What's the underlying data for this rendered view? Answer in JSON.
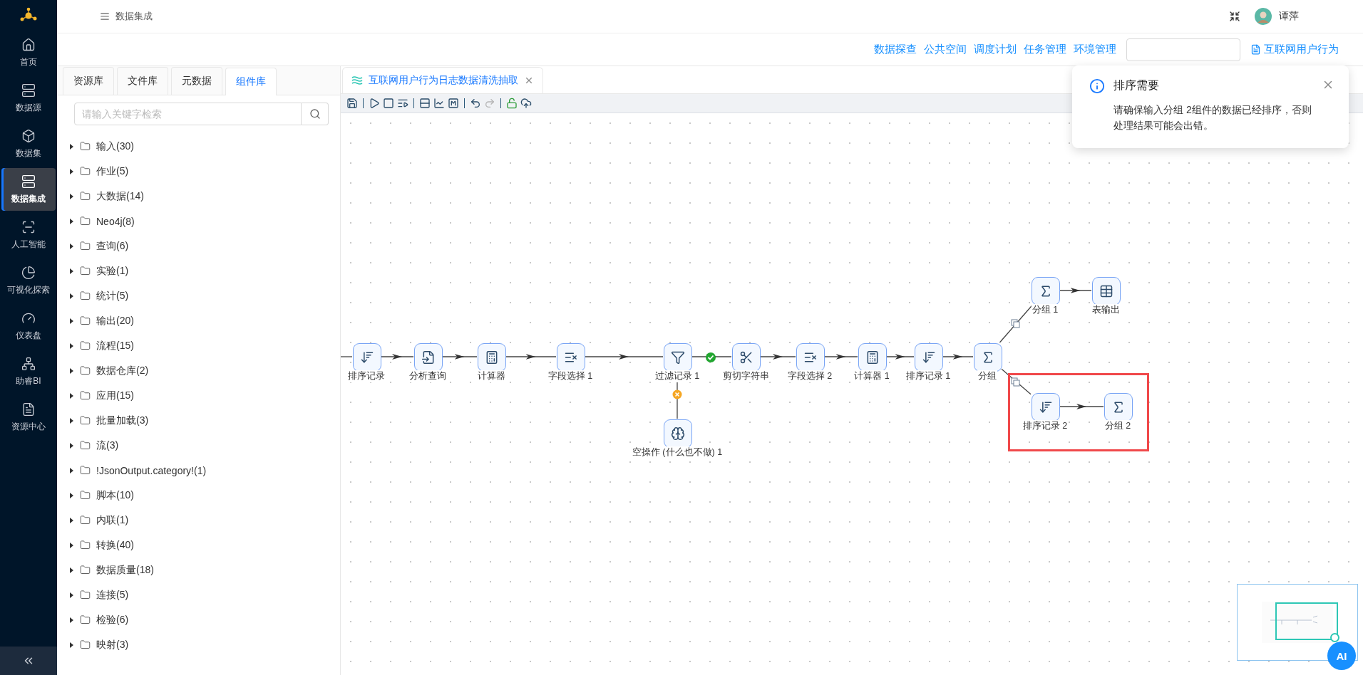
{
  "sidebar": {
    "items": [
      {
        "kind": "home",
        "label": "首页",
        "selected": false
      },
      {
        "kind": "datasource",
        "label": "数据源",
        "selected": false
      },
      {
        "kind": "dataset",
        "label": "数据集",
        "selected": false
      },
      {
        "kind": "integration",
        "label": "数据集成",
        "selected": true
      },
      {
        "kind": "ai",
        "label": "人工智能",
        "selected": false
      },
      {
        "kind": "chart",
        "label": "可视化探索",
        "selected": false
      },
      {
        "kind": "dashboard",
        "label": "仪表盘",
        "selected": false
      },
      {
        "kind": "bi",
        "label": "助睿BI",
        "selected": false
      },
      {
        "kind": "resource",
        "label": "资源中心",
        "selected": false
      }
    ]
  },
  "header": {
    "breadcrumb": "数据集成",
    "user": "谭萍"
  },
  "top_links": [
    "数据探查",
    "公共空间",
    "调度计划",
    "任务管理",
    "环境管理"
  ],
  "doc_link": "互联网用户行为",
  "left_panel": {
    "tabs": [
      {
        "label": "资源库",
        "selected": false
      },
      {
        "label": "文件库",
        "selected": false
      },
      {
        "label": "元数据",
        "selected": false
      },
      {
        "label": "组件库",
        "selected": true
      }
    ],
    "search": {
      "placeholder": "请输入关键字检索"
    },
    "tree": [
      {
        "label": "输入(30)",
        "expanded": false
      },
      {
        "label": "作业(5)",
        "expanded": false
      },
      {
        "label": "大数据(14)",
        "expanded": false
      },
      {
        "label": "Neo4j(8)",
        "expanded": false
      },
      {
        "label": "查询(6)",
        "expanded": false
      },
      {
        "label": "实验(1)",
        "expanded": false
      },
      {
        "label": "统计(5)",
        "expanded": false
      },
      {
        "label": "输出(20)",
        "expanded": false
      },
      {
        "label": "流程(15)",
        "expanded": false
      },
      {
        "label": "数据仓库(2)",
        "expanded": false
      },
      {
        "label": "应用(15)",
        "expanded": false
      },
      {
        "label": "批量加载(3)",
        "expanded": false
      },
      {
        "label": "流(3)",
        "expanded": false
      },
      {
        "label": "!JsonOutput.category!(1)",
        "expanded": false
      },
      {
        "label": "脚本(10)",
        "expanded": false
      },
      {
        "label": "内联(1)",
        "expanded": false
      },
      {
        "label": "转换(40)",
        "expanded": false
      },
      {
        "label": "数据质量(18)",
        "expanded": false
      },
      {
        "label": "连接(5)",
        "expanded": false
      },
      {
        "label": "检验(6)",
        "expanded": false
      },
      {
        "label": "映射(3)",
        "expanded": false
      }
    ]
  },
  "editor": {
    "tab": {
      "title": "互联网用户行为日志数据清洗抽取",
      "selected": true
    },
    "toolbar": [
      {
        "kind": "save",
        "disabled": false
      },
      {
        "kind": "run",
        "disabled": false
      },
      {
        "kind": "stop",
        "disabled": false
      },
      {
        "kind": "debug",
        "disabled": false
      },
      {
        "kind": "layout",
        "disabled": false
      },
      {
        "kind": "axes",
        "disabled": false
      },
      {
        "kind": "mbox",
        "disabled": false
      },
      {
        "kind": "undo",
        "disabled": false
      },
      {
        "kind": "redo",
        "disabled": true
      },
      {
        "kind": "unlock",
        "disabled": false
      },
      {
        "kind": "upload",
        "disabled": false
      }
    ],
    "nodes": [
      {
        "kind": "sort",
        "label": "排序记录"
      },
      {
        "kind": "analytic",
        "label": "分析查询"
      },
      {
        "kind": "calculator",
        "label": "计算器"
      },
      {
        "kind": "fields",
        "label": "字段选择 1"
      },
      {
        "kind": "filter",
        "label": "过滤记录 1"
      },
      {
        "kind": "cut",
        "label": "剪切字符串"
      },
      {
        "kind": "fields",
        "label": "字段选择 2"
      },
      {
        "kind": "calculator",
        "label": "计算器 1"
      },
      {
        "kind": "sort",
        "label": "排序记录 1"
      },
      {
        "kind": "group",
        "label": "分组"
      },
      {
        "kind": "group",
        "label": "分组 1"
      },
      {
        "kind": "table",
        "label": "表输出"
      },
      {
        "kind": "dummy",
        "label": "空操作 (什么也不做) 1"
      }
    ],
    "highlighted_group": [
      {
        "kind": "sort",
        "label": "排序记录 2"
      },
      {
        "kind": "group",
        "label": "分组 2"
      }
    ],
    "ai_button": "AI"
  },
  "notification": {
    "title": "排序需要",
    "message": "请确保输入分组 2组件的数据已经排序，否则处理结果可能会出错。"
  }
}
